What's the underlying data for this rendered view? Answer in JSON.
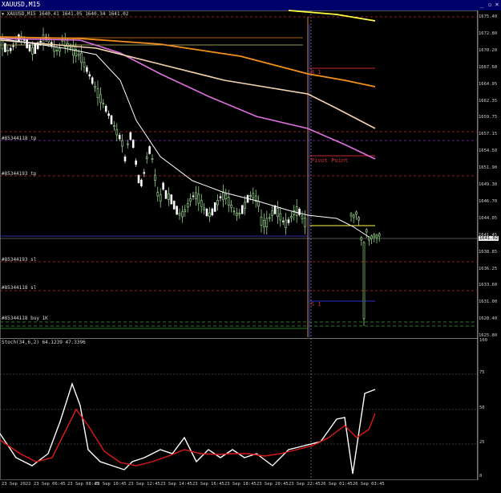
{
  "window": {
    "title": "XAUUSD,M15",
    "min_glyph": "_",
    "restore_glyph": "▫",
    "close_glyph": "×"
  },
  "info": {
    "symbol": "XAUUSD,M15",
    "ohlc": "1640.41 1641.05 1640.34 1641.02"
  },
  "price_axis": {
    "labels": [
      "1675.40",
      "1672.80",
      "1670.20",
      "1667.60",
      "1664.95",
      "1662.35",
      "1659.75",
      "1657.15",
      "1654.50",
      "1651.90",
      "1649.30",
      "1646.70",
      "1644.05",
      "1641.45",
      "1638.85",
      "1636.25",
      "1633.60",
      "1631.00",
      "1628.40",
      "1625.80"
    ],
    "current_price": "1641.02"
  },
  "time_axis": {
    "labels": [
      "23 Sep 2022",
      "23 Sep 06:45",
      "23 Sep 08:45",
      "23 Sep 10:45",
      "23 Sep 12:45",
      "23 Sep 14:45",
      "23 Sep 16:45",
      "23 Sep 18:45",
      "23 Sep 20:45",
      "23 Sep 22:45",
      "26 Sep 01:45",
      "26 Sep 03:45"
    ]
  },
  "order_labels": {
    "tp1": "#85344118 tp",
    "tp2": "#85344193 tp",
    "sl1": "#85344193 sl",
    "sl2": "#85344118 sl",
    "buy": "#85344118 buy 1K"
  },
  "pivot": {
    "r1": "R 1",
    "pivot": "Pivot Point",
    "s1": "S 1"
  },
  "stoch": {
    "title": "Stoch(34,6,2) 64.1239 47.3396",
    "levels": [
      "100",
      "75",
      "50",
      "25",
      "0"
    ]
  },
  "colors": {
    "bull_candle": "#a8f09a",
    "bear_candle": "#ffffff",
    "ma_white": "#ffffff",
    "ma_orange": "#f5901c",
    "ma_peach": "#f5d3b0",
    "ma_violet": "#e070e0",
    "ma_yellow": "#ffff40",
    "pivot_r": "#c82828",
    "pivot_blue": "#3030d0",
    "stoch_main": "#ffffff",
    "stoch_signal": "#e01818"
  }
}
